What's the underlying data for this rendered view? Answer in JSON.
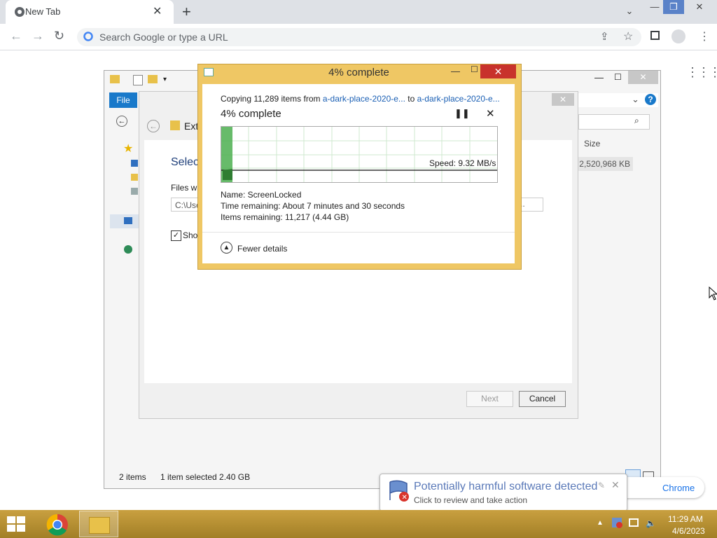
{
  "chrome": {
    "tab_title": "New Tab",
    "omnibox_placeholder": "Search Google or type a URL"
  },
  "explorer": {
    "file_tab": "File",
    "status_items": "2 items",
    "status_selected": "1 item selected  2.40 GB",
    "size_header": "Size",
    "size_value": "2,520,968 KB"
  },
  "wizard": {
    "header": "Ext",
    "select_heading": "Selec",
    "files_label": "Files wi",
    "path_value": "C:\\Use",
    "show_label": "Sho",
    "next_label": "Next",
    "cancel_label": "Cancel"
  },
  "copy": {
    "title": "4% complete",
    "line_prefix": "Copying 11,289 items from",
    "source": "a-dark-place-2020-e...",
    "to_word": "to",
    "dest": "a-dark-place-2020-e...",
    "percent_heading": "4% complete",
    "progress_fraction": 0.04,
    "speed": "Speed: 9.32 MB/s",
    "name": "Name:  ScreenLocked",
    "time_remaining": "Time remaining:  About 7 minutes and 30 seconds",
    "items_remaining": "Items remaining:  11,217 (4.44 GB)",
    "fewer_details": "Fewer details"
  },
  "toast": {
    "title": "Potentially harmful software detected",
    "subtitle": "Click to review and take action"
  },
  "chrome_pill": {
    "text": "Chrome"
  },
  "clock": {
    "time": "11:29 AM",
    "date": "4/6/2023"
  },
  "colors": {
    "progress_green": "#4caf50",
    "taskbar": "#b8912e",
    "copy_frame": "#efc764"
  }
}
